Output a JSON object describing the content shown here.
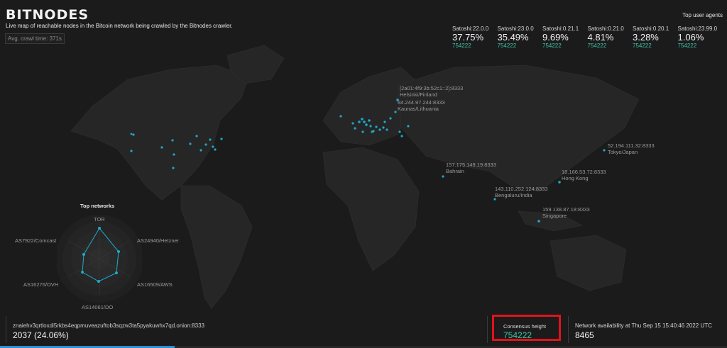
{
  "header": {
    "logo": "BITNODES",
    "subtitle": "Live map of reachable nodes in the Bitcoin network being crawled by the Bitnodes crawler.",
    "crawl_time": "Avg. crawl time: 371s"
  },
  "user_agents": {
    "title": "Top user agents",
    "items": [
      {
        "name": "Satoshi:22.0.0",
        "percent": "37.75%",
        "height": "754222"
      },
      {
        "name": "Satoshi:23.0.0",
        "percent": "35.49%",
        "height": "754222"
      },
      {
        "name": "Satoshi:0.21.1",
        "percent": "9.69%",
        "height": "754222"
      },
      {
        "name": "Satoshi:0.21.0",
        "percent": "4.81%",
        "height": "754222"
      },
      {
        "name": "Satoshi:0.20.1",
        "percent": "3.28%",
        "height": "754222"
      },
      {
        "name": "Satoshi:23.99.0",
        "percent": "1.06%",
        "height": "754222"
      }
    ]
  },
  "node_labels": [
    {
      "address": "[2a01:4f9:3b:52c1::2]:8333",
      "location": "Helsinki/Finland"
    },
    {
      "address": "84.244.97.244:8333",
      "location": "Kaunas/Lithuania"
    },
    {
      "address": "52.194.111.32:8333",
      "location": "Tokyo/Japan"
    },
    {
      "address": "157.175.149.19:8333",
      "location": "Bahrain"
    },
    {
      "address": "18.166.53.72:8333",
      "location": "Hong Kong"
    },
    {
      "address": "143.110.252.124:8333",
      "location": "Bengaluru/India"
    },
    {
      "address": "159.138.87.18:8333",
      "location": "Singapore"
    }
  ],
  "networks": {
    "title": "Top networks",
    "labels": [
      "TOR",
      "AS24940/Hetzner",
      "AS16509/AWS",
      "AS14061/DO",
      "AS16276/OVH",
      "AS7922/Comcast"
    ]
  },
  "bottom": {
    "onion_address": "znaiehv3qrtloxdi5rkbs4eqpmuveazuftob3sqzw3ta5pyakuwhx7qd.onion:8333",
    "onion_count": "2037 (24.06%)",
    "consensus_label": "Consensus height",
    "consensus_value": "754222",
    "availability_label": "Network availability at Thu Sep 15 15:40:46 2022 UTC",
    "availability_count": "8465",
    "crawl_progress": 0.24
  },
  "colors": {
    "accent": "#3cc7a8",
    "node_dot": "#1fa8c9",
    "highlight_border": "#e3121a",
    "progress": "#2f8ed0"
  }
}
